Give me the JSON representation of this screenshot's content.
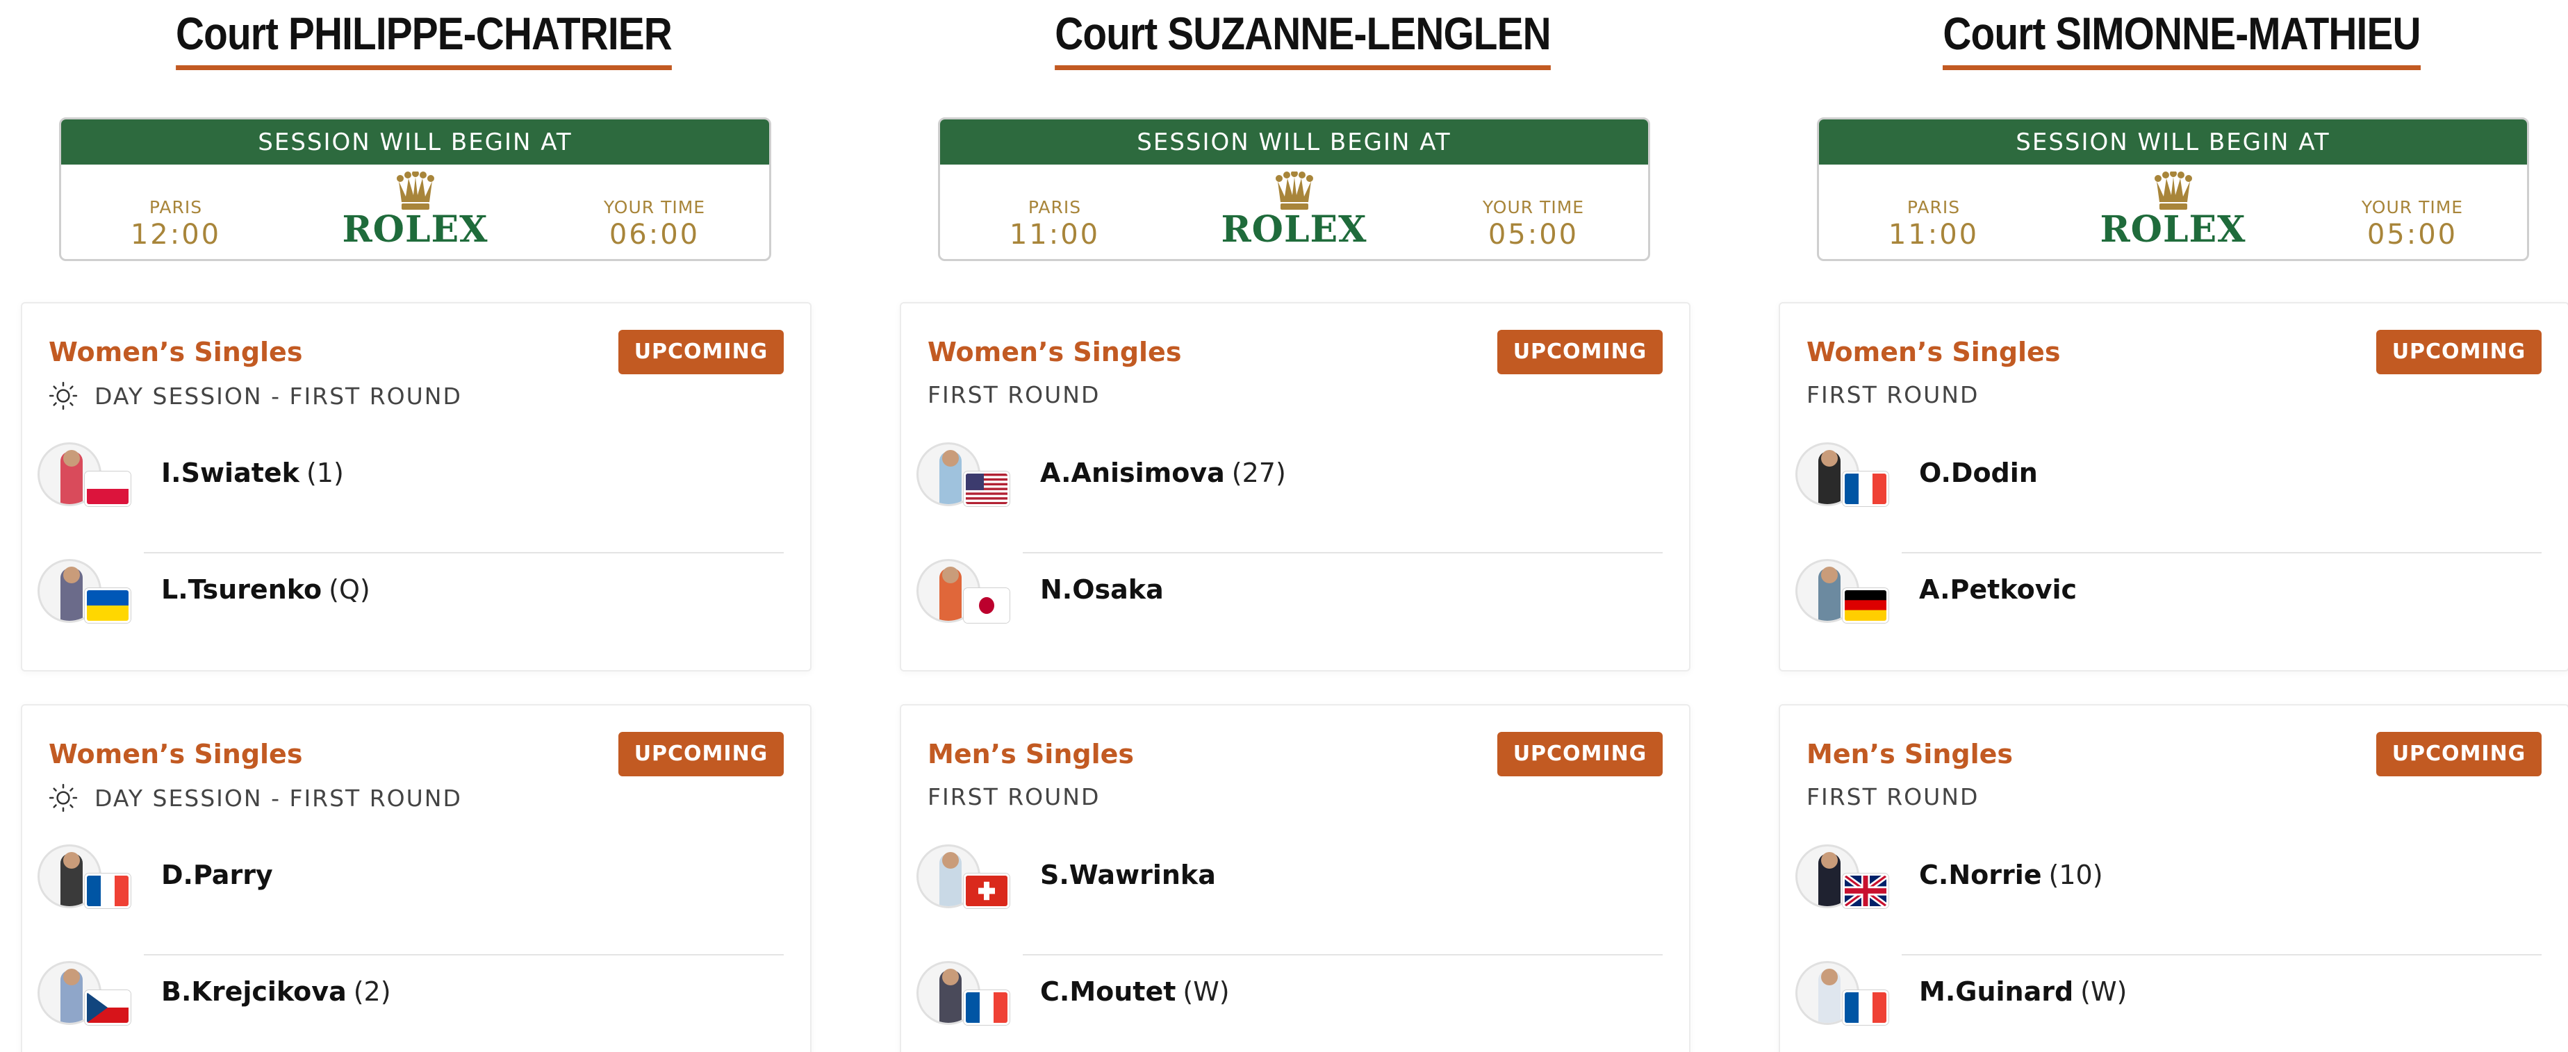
{
  "session_label": "SESSION WILL BEGIN AT",
  "paris_label": "PARIS",
  "your_time_label": "YOUR TIME",
  "sponsor": "ROLEX",
  "courts": [
    {
      "name": "Court PHILIPPE-CHATRIER",
      "paris_time": "12:00",
      "your_time": "06:00",
      "matches": [
        {
          "event": "Women’s Singles",
          "status": "UPCOMING",
          "round": "DAY SESSION - FIRST ROUND",
          "players": [
            {
              "name": "I.Swiatek",
              "seed": "(1)",
              "flag": "Poland"
            },
            {
              "name": "L.Tsurenko",
              "seed": "(Q)",
              "flag": "Ukraine"
            }
          ]
        },
        {
          "event": "Women’s Singles",
          "status": "UPCOMING",
          "round": "DAY SESSION - FIRST ROUND",
          "players": [
            {
              "name": "D.Parry",
              "seed": "",
              "flag": "France"
            },
            {
              "name": "B.Krejcikova",
              "seed": "(2)",
              "flag": "Czech Republic"
            }
          ]
        }
      ]
    },
    {
      "name": "Court SUZANNE-LENGLEN",
      "paris_time": "11:00",
      "your_time": "05:00",
      "matches": [
        {
          "event": "Women’s Singles",
          "status": "UPCOMING",
          "round": "FIRST ROUND",
          "players": [
            {
              "name": "A.Anisimova",
              "seed": "(27)",
              "flag": "USA"
            },
            {
              "name": "N.Osaka",
              "seed": "",
              "flag": "Japan"
            }
          ]
        },
        {
          "event": "Men’s Singles",
          "status": "UPCOMING",
          "round": "FIRST ROUND",
          "players": [
            {
              "name": "S.Wawrinka",
              "seed": "",
              "flag": "Switzerland"
            },
            {
              "name": "C.Moutet",
              "seed": "(W)",
              "flag": "France"
            }
          ]
        }
      ]
    },
    {
      "name": "Court SIMONNE-MATHIEU",
      "paris_time": "11:00",
      "your_time": "05:00",
      "matches": [
        {
          "event": "Women’s Singles",
          "status": "UPCOMING",
          "round": "FIRST ROUND",
          "players": [
            {
              "name": "O.Dodin",
              "seed": "",
              "flag": "France"
            },
            {
              "name": "A.Petkovic",
              "seed": "",
              "flag": "Germany"
            }
          ]
        },
        {
          "event": "Men’s Singles",
          "status": "UPCOMING",
          "round": "FIRST ROUND",
          "players": [
            {
              "name": "C.Norrie",
              "seed": "(10)",
              "flag": "Great Britain"
            },
            {
              "name": "M.Guinard",
              "seed": "(W)",
              "flag": "France"
            }
          ]
        }
      ]
    }
  ],
  "colors": {
    "accent": "#c25a22",
    "session_green": "#2d6a3e",
    "rolex_gold": "#a8853a",
    "rolex_green": "#1f6b3b"
  }
}
